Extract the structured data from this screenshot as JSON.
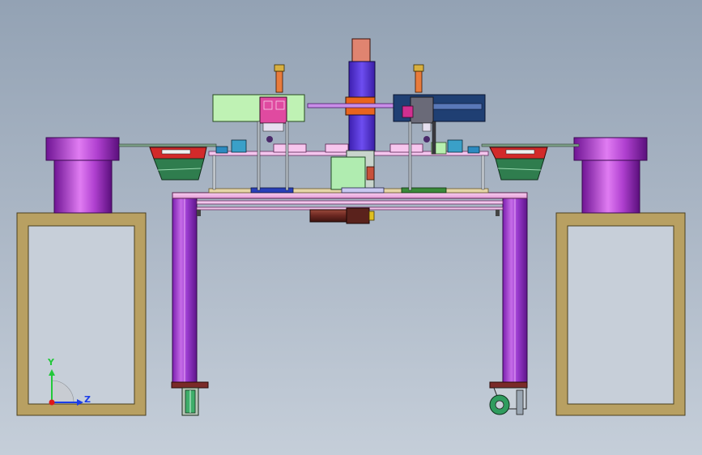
{
  "scene": {
    "background_top": "#93a2b4",
    "background_bottom": "#c5ced9"
  },
  "colors": {
    "frame_tan": "#b8a062",
    "frame_inner": "#c4ccd6",
    "purple": "#a12bc7",
    "purple_light": "#e079f0",
    "column_purple": "#8f36c9",
    "blue_block": "#5a35d8",
    "orange_block": "#e8641e",
    "light_green": "#b8f0b0",
    "dark_blue": "#1f3d73",
    "red": "#d42020",
    "dark_green": "#2e7a4c",
    "pink": "#f4b6e6",
    "brown": "#6e2a22"
  },
  "axes": {
    "y_label": "Y",
    "z_label": "Z",
    "y_color": "#22c83a",
    "z_color": "#1c3ee8",
    "x_color": "#e01818"
  },
  "components": [
    "left-base-frame",
    "right-base-frame",
    "left-vibratory-bowl",
    "right-vibratory-bowl",
    "main-table-frame",
    "center-lift-column",
    "left-press-head",
    "right-press-head",
    "left-feed-track",
    "right-feed-track",
    "servo-motor",
    "caster-wheel",
    "leveling-foot"
  ]
}
